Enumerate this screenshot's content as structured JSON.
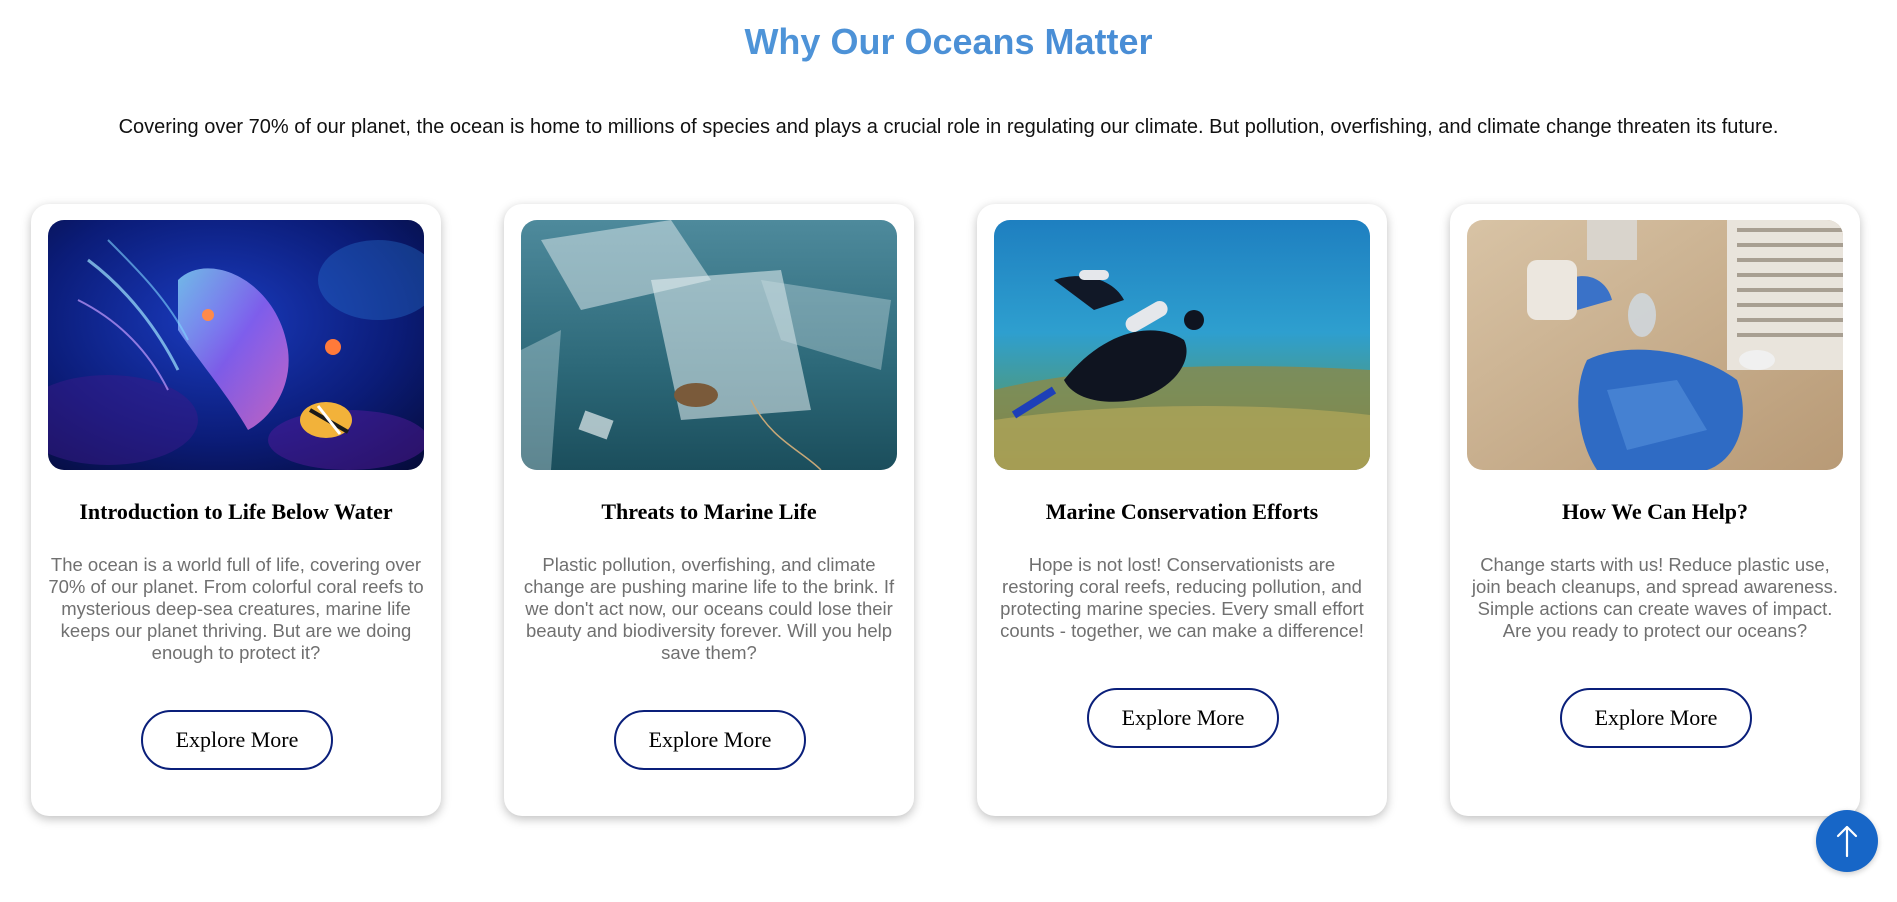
{
  "header": {
    "title": "Why Our Oceans Matter",
    "intro": "Covering over 70% of our planet, the ocean is home to millions of species and plays a crucial role in regulating our climate. But pollution, overfishing, and climate change threaten its future."
  },
  "cards": [
    {
      "title": "Introduction to Life Below Water",
      "text": "The ocean is a world full of life, covering over 70% of our planet. From colorful coral reefs to mysterious deep-sea creatures, marine life keeps our planet thriving. But are we doing enough to protect it?",
      "button_label": "Explore More",
      "image": "jellyfish-photo"
    },
    {
      "title": "Threats to Marine Life",
      "text": "Plastic pollution, overfishing, and climate change are pushing marine life to the brink. If we don't act now, our oceans could lose their beauty and biodiversity forever. Will you help save them?",
      "button_label": "Explore More",
      "image": "plastic-pollution-photo"
    },
    {
      "title": "Marine Conservation Efforts",
      "text": "Hope is not lost! Conservationists are restoring coral reefs, reducing pollution, and protecting marine species. Every small effort counts - together, we can make a difference!",
      "button_label": "Explore More",
      "image": "scuba-divers-photo"
    },
    {
      "title": "How We Can Help?",
      "text": "Change starts with us! Reduce plastic use, join beach cleanups, and spread awareness. Simple actions can create waves of impact. Are you ready to protect our oceans?",
      "button_label": "Explore More",
      "image": "beach-cleanup-photo"
    }
  ],
  "scroll_top": {
    "icon": "arrow-up-icon"
  },
  "colors": {
    "title_gradient_start": "#5aa2dd",
    "title_gradient_end": "#3d7fd0",
    "button_border": "#0a1f7a",
    "scroll_button": "#1766c7",
    "card_text": "#707070"
  }
}
